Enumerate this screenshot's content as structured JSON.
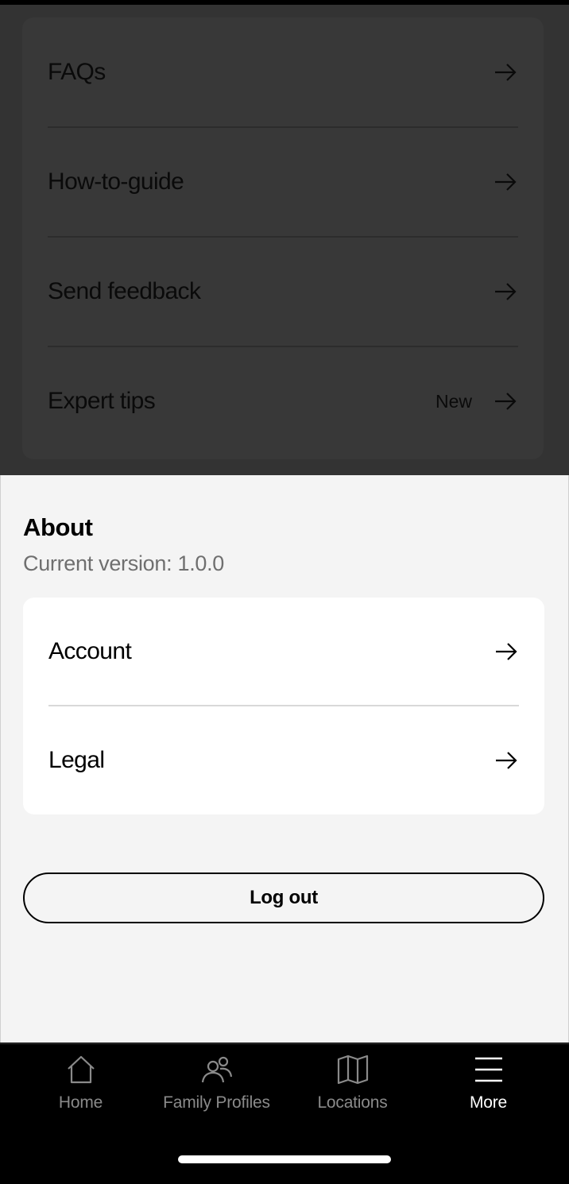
{
  "support": {
    "items": [
      {
        "label": "FAQs",
        "badge": ""
      },
      {
        "label": "How-to-guide",
        "badge": ""
      },
      {
        "label": "Send feedback",
        "badge": ""
      },
      {
        "label": "Expert tips",
        "badge": "New"
      }
    ]
  },
  "about": {
    "title": "About",
    "version": "Current version: 1.0.0",
    "items": [
      {
        "label": "Account"
      },
      {
        "label": "Legal"
      }
    ]
  },
  "actions": {
    "logout_label": "Log out"
  },
  "tabbar": {
    "tabs": [
      {
        "label": "Home",
        "icon": "home-icon",
        "active": false
      },
      {
        "label": "Family Profiles",
        "icon": "family-profiles-icon",
        "active": false
      },
      {
        "label": "Locations",
        "icon": "map-icon",
        "active": false
      },
      {
        "label": "More",
        "icon": "menu-icon",
        "active": true
      }
    ]
  },
  "colors": {
    "overlay": "#333333",
    "sheet": "#f4f4f4",
    "tabbar": "#000000",
    "tab_inactive": "#8a8a8a",
    "tab_active": "#ffffff"
  }
}
